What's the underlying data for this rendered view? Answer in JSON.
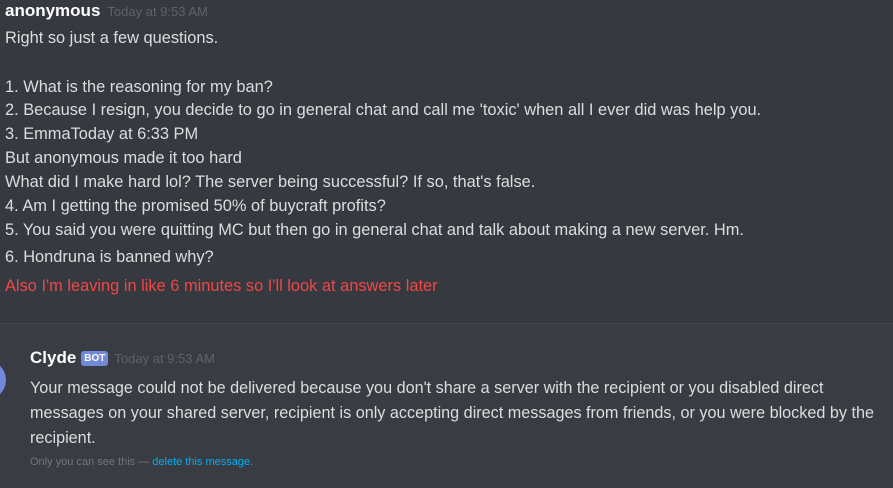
{
  "message1": {
    "author": "anonymous",
    "timestamp": "Today at 9:53 AM",
    "lines": [
      "Right so just a few questions.",
      "1. What is the reasoning for my ban?",
      "2. Because I resign, you decide to go in general chat and  call me 'toxic' when all I ever did was help you.",
      "3. EmmaToday at 6:33 PM",
      "But anonymous made it too hard",
      "What did I make hard lol? The server being successful? If so, that's false.",
      "4. Am I getting the promised 50% of buycraft profits?",
      "5. You said you were quitting MC but then go in general chat and talk about  making a new server. Hm.",
      "6. Hondruna is banned why?"
    ],
    "highlight_line": "Also I'm leaving in like 6 minutes so I'll look at answers later",
    "highlight_color": "#f04747"
  },
  "message2": {
    "author": "Clyde",
    "bot_tag": "BOT",
    "timestamp": "Today at 9:53 AM",
    "body": "Your message could not be delivered because you don't share a server with the recipient or you disabled direct messages on your shared server, recipient is only accepting direct messages from friends, or you were blocked by the recipient.",
    "ephemeral_note": "Only you can see this — ",
    "delete_link": "delete this message."
  },
  "colors": {
    "background": "#36393f",
    "text": "#dcddde",
    "bot_tag": "#7289da",
    "link": "#00b0f4"
  }
}
